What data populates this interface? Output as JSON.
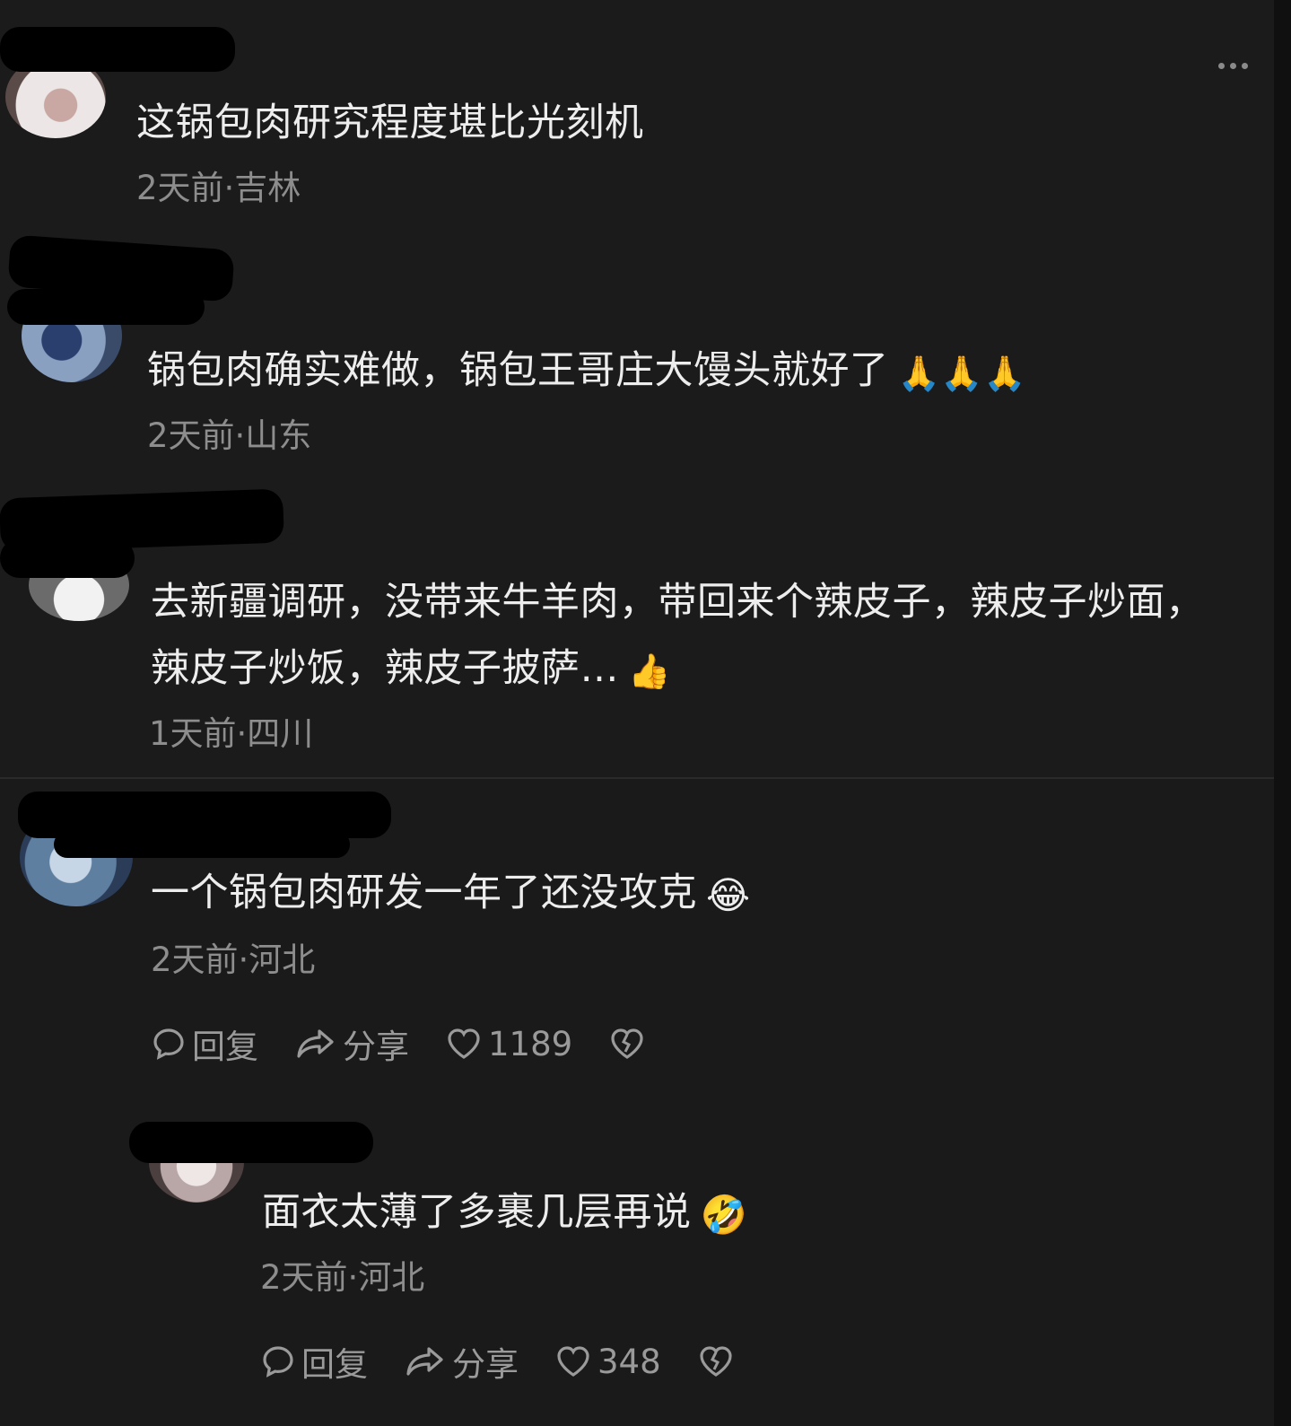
{
  "comments": [
    {
      "text": "这锅包肉研究程度堪比光刻机",
      "time": "2天前",
      "location": "吉林",
      "meta": "2天前·吉林"
    },
    {
      "text": "锅包肉确实难做，锅包王哥庄大馒头就好了",
      "emoji": "🙏🙏🙏",
      "meta": "2天前·山东"
    },
    {
      "text_line1": "去新疆调研，没带来牛羊肉，带回来个辣皮子，辣皮子炒面，",
      "text_line2": "辣皮子炒饭，辣皮子披萨…",
      "emoji": "👍",
      "meta": "1天前·四川"
    },
    {
      "text": "一个锅包肉研发一年了还没攻克",
      "emoji": "😂",
      "meta": "2天前·河北",
      "actions": {
        "reply": "回复",
        "share": "分享",
        "likes": "1189"
      }
    },
    {
      "text": "面衣太薄了多裹几层再说",
      "emoji": "🤣",
      "meta": "2天前·河北",
      "actions": {
        "reply": "回复",
        "share": "分享",
        "likes": "348"
      }
    }
  ],
  "icons": {
    "more": "more-dots-icon",
    "reply": "chat-bubble-icon",
    "share": "share-arrow-icon",
    "like": "heart-icon",
    "dislike": "broken-heart-icon"
  },
  "colors": {
    "background": "#1b1b1b",
    "text": "#ededed",
    "meta": "#8d8d8d",
    "icon": "#9a9a9a"
  }
}
